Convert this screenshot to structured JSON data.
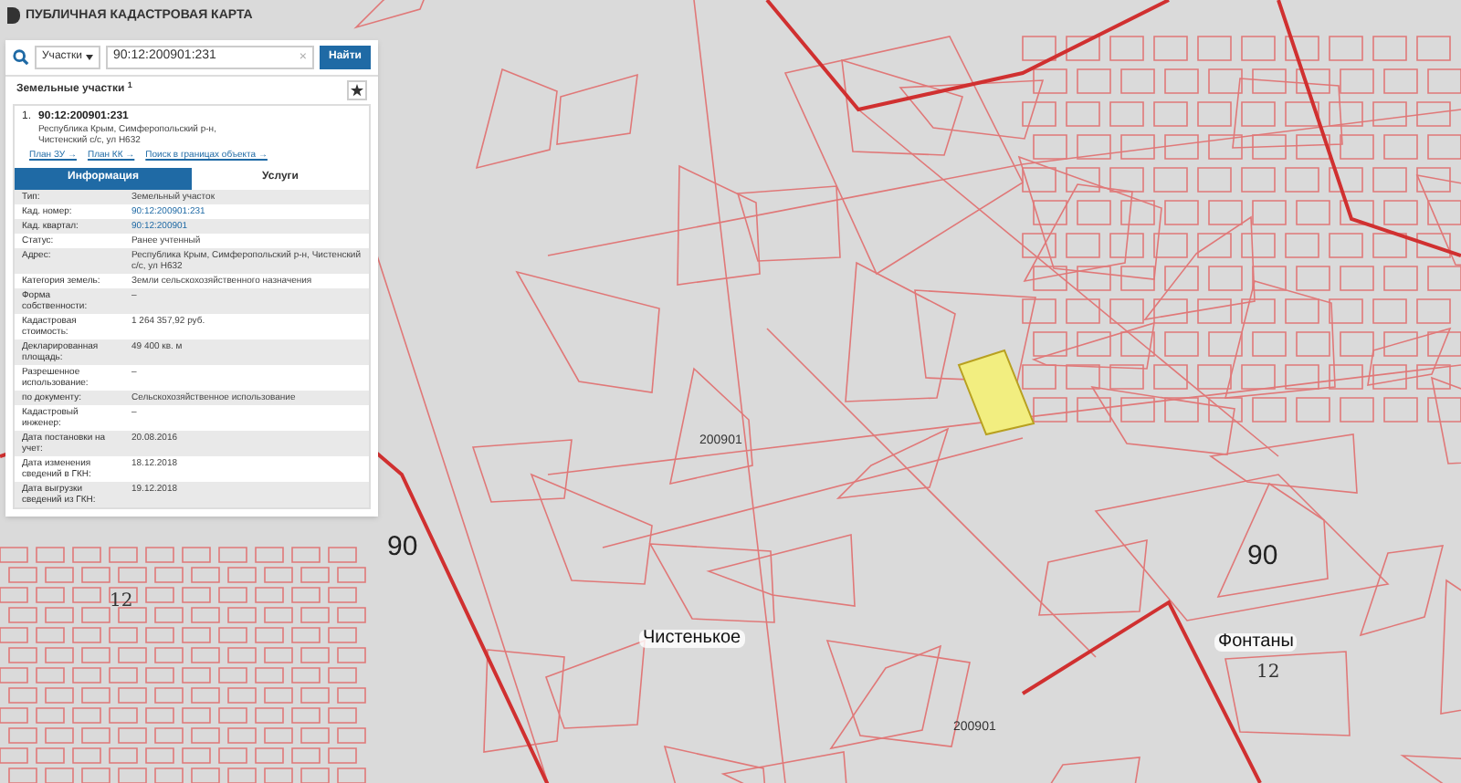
{
  "app_title": "ПУБЛИЧНАЯ КАДАСТРОВАЯ КАРТА",
  "search": {
    "category": "Участки",
    "value": "90:12:200901:231",
    "clear": "×",
    "button": "Найти"
  },
  "results": {
    "heading": "Земельные участки $^{1}$",
    "item": {
      "number": "1.",
      "cadastral_number": "90:12:200901:231",
      "address": "Республика Крым, Симферопольский р-н, Чистенский с/с, ул Н632",
      "links": [
        "План ЗУ →",
        "План КК →",
        "Поиск в границах объекта →"
      ]
    },
    "tabs": [
      {
        "label": "Информация",
        "selected": true
      },
      {
        "label": "Услуги",
        "selected": false
      }
    ],
    "rows": [
      {
        "label": "Тип:",
        "value": "Земельный участок",
        "kind": "text"
      },
      {
        "label": "Кад. номер:",
        "value": "90:12:200901:231",
        "kind": "link"
      },
      {
        "label": "Кад. квартал:",
        "value": "90:12:200901",
        "kind": "link"
      },
      {
        "label": "Статус:",
        "value": "Ранее учтенный",
        "kind": "text"
      },
      {
        "label": "Адрес:",
        "value": "Республика Крым, Симферопольский р-н, Чистенский с/с, ул Н632",
        "kind": "text"
      },
      {
        "label": "Категория земель:",
        "value": "Земли сельскохозяйственного назначения",
        "kind": "text"
      },
      {
        "label": "Форма собственности:",
        "value": "–",
        "kind": "text"
      },
      {
        "label": "Кадастровая стоимость:",
        "value": "1 264 357,92 руб.",
        "kind": "text"
      },
      {
        "label": "Декларированная площадь:",
        "value": "49 400 кв. м",
        "kind": "text"
      },
      {
        "label": "Разрешенное использование:",
        "value": "–",
        "kind": "text"
      },
      {
        "label": "по документу:",
        "value": "Сельскохозяйственное использование",
        "kind": "text"
      },
      {
        "label": "Кадастровый инженер:",
        "value": "–",
        "kind": "text"
      },
      {
        "label": "Дата постановки на учет:",
        "value": "20.08.2016",
        "kind": "text"
      },
      {
        "label": "Дата изменения сведений в ГКН:",
        "value": "18.12.2018",
        "kind": "text"
      },
      {
        "label": "Дата выгрузки сведений из ГКН:",
        "value": "19.12.2018",
        "kind": "text"
      }
    ]
  },
  "map": {
    "labels": [
      {
        "text": "90",
        "kind": "zone"
      },
      {
        "text": "90",
        "kind": "zone"
      },
      {
        "text": "Чистенькое",
        "kind": "place"
      },
      {
        "text": "Фонтаны",
        "kind": "place"
      },
      {
        "text": "12",
        "kind": "district"
      },
      {
        "text": "12",
        "kind": "district"
      },
      {
        "text": "200901",
        "kind": "quarter"
      },
      {
        "text": "200901",
        "kind": "quarter"
      }
    ]
  }
}
